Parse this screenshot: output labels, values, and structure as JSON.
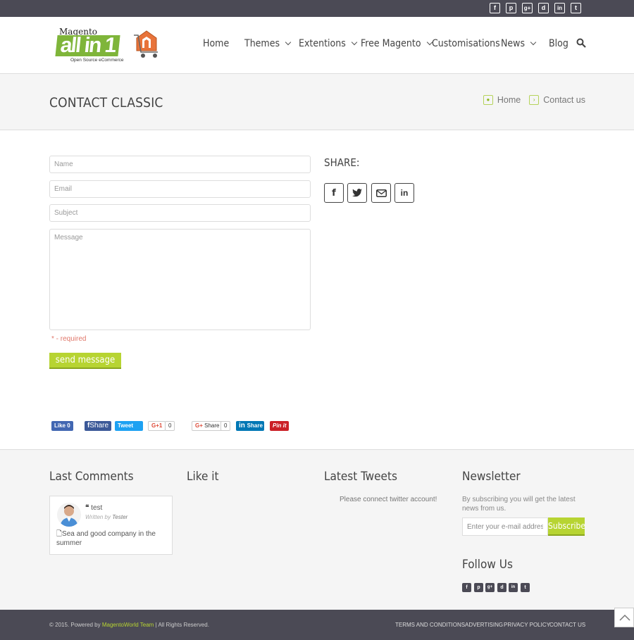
{
  "topbar": {
    "social": [
      "f",
      "p",
      "g+",
      "d",
      "in",
      "t"
    ]
  },
  "logo": {
    "magento": "Magento",
    "allin": "all in 1",
    "tagline": "Open Source eCommerce"
  },
  "nav": {
    "items": [
      {
        "label": "Home"
      },
      {
        "label": "Themes"
      },
      {
        "label": "Extentions"
      },
      {
        "label": "Free Magento"
      },
      {
        "label": "Customisations"
      },
      {
        "label": "News"
      },
      {
        "label": "Blog"
      }
    ]
  },
  "page": {
    "title": "CONTACT CLASSIC"
  },
  "breadcrumb": {
    "home": "Home",
    "current": "Contact us"
  },
  "form": {
    "name_placeholder": "Name",
    "email_placeholder": "Email",
    "subject_placeholder": "Subject",
    "message_placeholder": "Message",
    "required_star": "*",
    "required_label": " - required",
    "send_label": "send message"
  },
  "share": {
    "title": "SHARE:",
    "buttons": [
      "facebook",
      "twitter",
      "email",
      "linkedin"
    ]
  },
  "social_row": {
    "like": "Like 0",
    "fshare": "Share",
    "tweet": "Tweet",
    "gplus": "G+1",
    "gplus_count": "0",
    "gshare": "Share",
    "gshare_count": "0",
    "in_share": "Share",
    "pinit": "Pin it"
  },
  "footer": {
    "last_comments_title": "Last Comments",
    "like_title": "Like it",
    "tweets_title": "Latest Tweets",
    "newsletter_title": "Newsletter",
    "follow_title": "Follow Us",
    "comment": {
      "author": "test",
      "written_by": "Written by",
      "writer": "Tester",
      "text": "Sea and good company in the summer"
    },
    "tweets_msg": "Please connect twitter account!",
    "newsletter_text": "By subscribing you will get the latest news from us.",
    "newsletter_placeholder": "Enter your e-mail address",
    "subscribe_label": "Subscribe",
    "follow_social": [
      "f",
      "p",
      "g+",
      "d",
      "in",
      "t"
    ]
  },
  "bottombar": {
    "copyright_prefix": "© 2015. Powered by ",
    "copyright_team": "MagentoWorld Team",
    "copyright_suffix": " | All Rights Reserved.",
    "links": [
      "TERMS AND CONDITIONS",
      "ADVERTISING",
      "PRIVACY POLICY",
      "CONTACT US"
    ]
  },
  "colors": {
    "accent": "#b7d432",
    "dark": "#4b4a55",
    "bg_light": "#f5f5f5"
  }
}
